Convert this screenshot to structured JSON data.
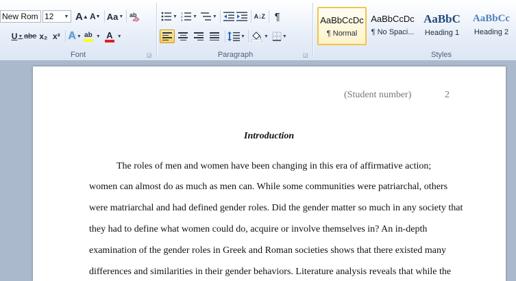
{
  "font_group": {
    "label": "Font",
    "font_name": "New Rom",
    "font_size": "12",
    "grow_label": "A",
    "shrink_label": "A",
    "change_case_label": "Aa",
    "underline_label": "U",
    "strike_label": "abe",
    "subscript_label": "x₂",
    "superscript_label": "x²",
    "text_effects_label": "A",
    "highlight_label": "ab",
    "font_color_label": "A"
  },
  "paragraph_group": {
    "label": "Paragraph",
    "sort_label": "A↓Z",
    "pilcrow_label": "¶"
  },
  "styles_group": {
    "label": "Styles",
    "items": [
      {
        "sample": "AaBbCcDc",
        "name": "¶ Normal"
      },
      {
        "sample": "AaBbCcDc",
        "name": "¶ No Spaci..."
      },
      {
        "sample": "AaBbC",
        "name": "Heading 1"
      },
      {
        "sample": "AaBbCc",
        "name": "Heading 2"
      }
    ]
  },
  "colors": {
    "accent_selected": "#f2c548",
    "highlight": "#ffff00",
    "font_color": "#e02020",
    "heading": "#1f497d"
  },
  "document": {
    "header_text": "(Student number)",
    "page_number": "2",
    "heading": "Introduction",
    "lines": [
      "The roles of men and women have been changing in this era of affirmative action;",
      "women can almost do as much as men can. While some communities were patriarchal, others",
      "were matriarchal and had defined gender roles. Did the gender matter so much in any society that",
      "they had to define what women could do, acquire or involve themselves in? An in-depth",
      "examination of the gender roles in Greek and Roman societies shows that there existed many",
      "differences and similarities in their gender behaviors. Literature analysis reveals that while the"
    ]
  }
}
